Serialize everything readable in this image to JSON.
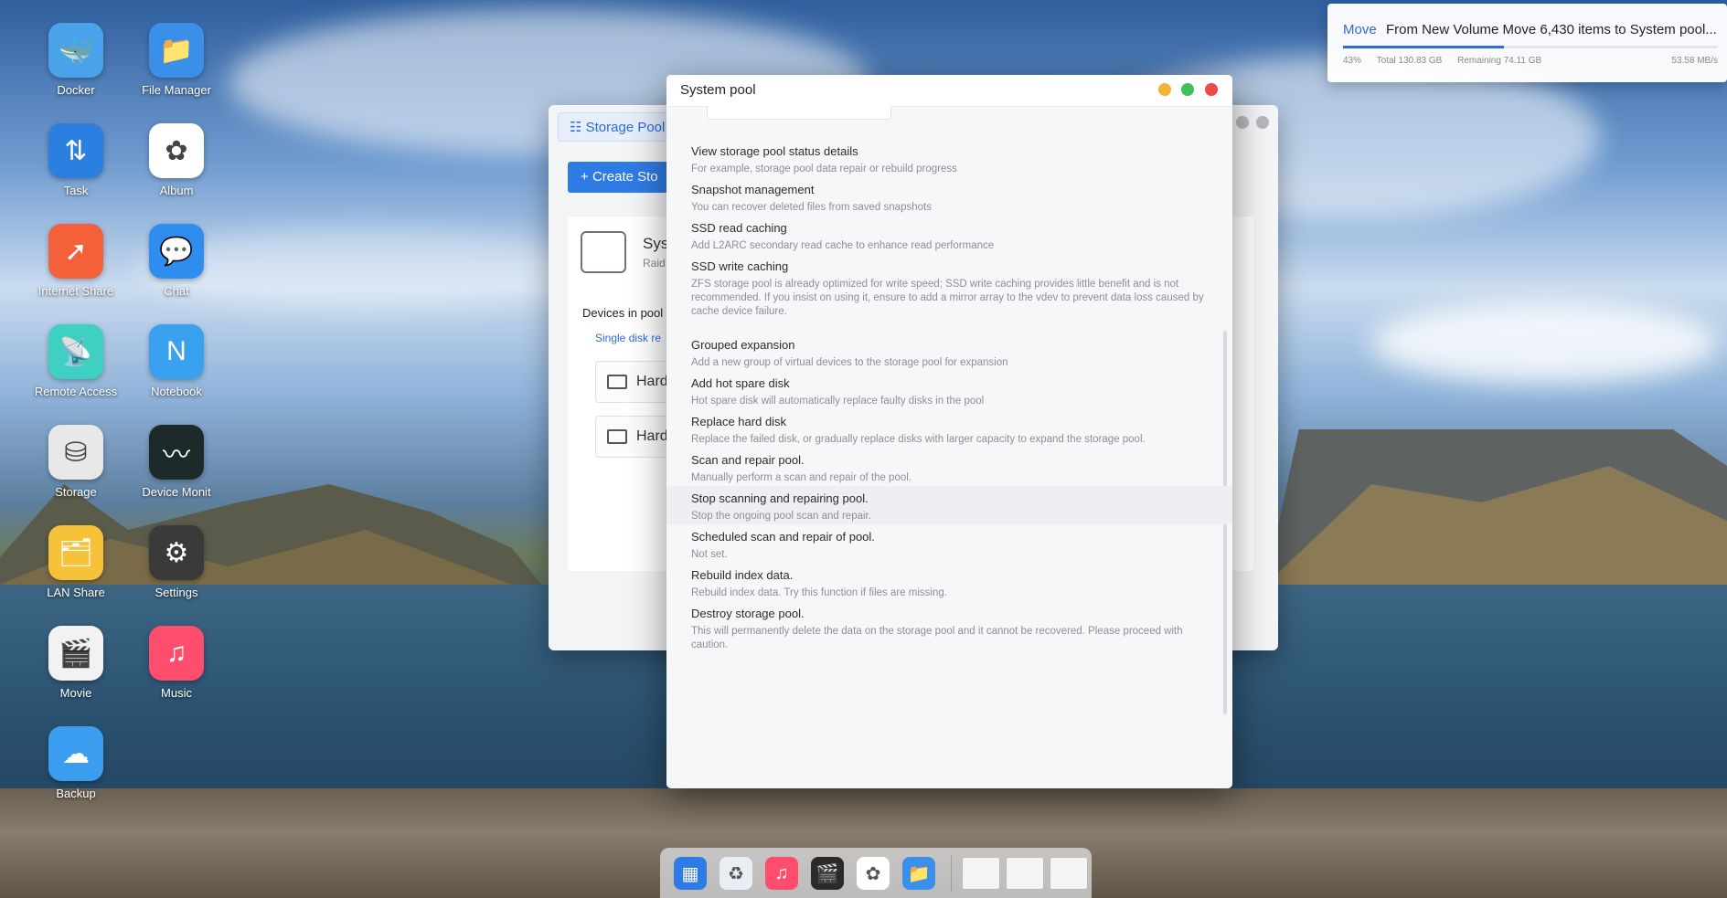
{
  "desktop_icons": [
    {
      "label": "Docker",
      "icon": "whale-icon",
      "color": "#4aa3ea"
    },
    {
      "label": "File Manager",
      "icon": "folder-icon",
      "color": "#3a8fe8"
    },
    {
      "label": "Task",
      "icon": "transfer-arrows-icon",
      "color": "#2a7fe0"
    },
    {
      "label": "Album",
      "icon": "pinwheel-icon",
      "color": "#ffffff"
    },
    {
      "label": "Internet Share",
      "icon": "share-arrow-icon",
      "color": "#f4603a"
    },
    {
      "label": "Chat",
      "icon": "chat-bubble-icon",
      "color": "#2f8df0"
    },
    {
      "label": "Remote Access",
      "icon": "broadcast-icon",
      "color": "#3ed0c0"
    },
    {
      "label": "Notebook",
      "icon": "notebook-icon",
      "color": "#3aa0f0"
    },
    {
      "label": "Storage",
      "icon": "disk-drive-icon",
      "color": "#e8e8e8"
    },
    {
      "label": "Device Monit",
      "icon": "heartbeat-icon",
      "color": "#1d2a2a"
    },
    {
      "label": "LAN Share",
      "icon": "lan-folder-icon",
      "color": "#f6c23a"
    },
    {
      "label": "Settings",
      "icon": "gear-icon",
      "color": "#3a3a3a"
    },
    {
      "label": "Movie",
      "icon": "clapper-icon",
      "color": "#f2f2f2"
    },
    {
      "label": "Music",
      "icon": "music-note-icon",
      "color": "#ff4d6d"
    },
    {
      "label": "Backup",
      "icon": "cloud-icon",
      "color": "#3a9df0"
    }
  ],
  "background_window": {
    "tab_label": "Storage Pool",
    "create_label": "Create Sto",
    "pool_name": "Sys",
    "pool_raid": "Raid",
    "devices_label": "Devices in pool",
    "single_disk_label": "Single disk re",
    "disk_labels": [
      "Hard",
      "Hard"
    ]
  },
  "dialog": {
    "title": "System pool",
    "items": [
      {
        "title": "View storage pool status details",
        "desc": "For example, storage pool data repair or rebuild progress"
      },
      {
        "title": "Snapshot management",
        "desc": "You can recover deleted files from saved snapshots"
      },
      {
        "title": "SSD read caching",
        "desc": "Add L2ARC secondary read cache to enhance read performance"
      },
      {
        "title": "SSD write caching",
        "desc": "ZFS storage pool is already optimized for write speed; SSD write caching provides little benefit and is not recommended. If you insist on using it, ensure to add a mirror array to the vdev to prevent data loss caused by cache device failure."
      },
      {
        "title": "Grouped expansion",
        "desc": "Add a new group of virtual devices to the storage pool for expansion"
      },
      {
        "title": "Add hot spare disk",
        "desc": "Hot spare disk will automatically replace faulty disks in the pool"
      },
      {
        "title": "Replace hard disk",
        "desc": "Replace the failed disk, or gradually replace disks with larger capacity to expand the storage pool."
      },
      {
        "title": "Scan and repair pool.",
        "desc": "Manually perform a scan and repair of the pool."
      },
      {
        "title": "Stop scanning and repairing pool.",
        "desc": "Stop the ongoing pool scan and repair."
      },
      {
        "title": "Scheduled scan and repair of pool.",
        "desc": "Not set."
      },
      {
        "title": "Rebuild index data.",
        "desc": "Rebuild index data. Try this function if files are missing."
      },
      {
        "title": "Destroy storage pool.",
        "desc": "This will permanently delete the data on the storage pool and it cannot be recovered. Please proceed with caution."
      }
    ]
  },
  "notification": {
    "action": "Move",
    "message": "From New Volume Move 6,430 items to System pool...",
    "percent": "43%",
    "progress": 0.43,
    "total": "Total 130.83 GB",
    "remaining": "Remaining 74.11 GB",
    "speed": "53.58 MB/s"
  },
  "dock": {
    "items": [
      {
        "icon": "app-grid-icon",
        "color": "#2f7be6"
      },
      {
        "icon": "recycle-icon",
        "color": "#e9eef5"
      },
      {
        "icon": "music-note-icon",
        "color": "#ff4d6d"
      },
      {
        "icon": "clapper-icon",
        "color": "#2b2b2b"
      },
      {
        "icon": "pinwheel-icon",
        "color": "#ffffff"
      },
      {
        "icon": "folder-icon",
        "color": "#3a8fe8"
      }
    ]
  }
}
